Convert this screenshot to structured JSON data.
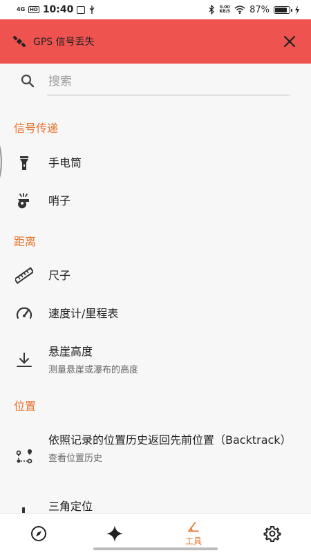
{
  "status_bar": {
    "network": "4G",
    "hd": "HD",
    "time": "10:40",
    "net_speed_value": "0.00",
    "net_speed_unit": "KB/S",
    "battery": "87%",
    "battery_level": 0.87
  },
  "gps_banner": {
    "text": "GPS 信号丢失"
  },
  "search": {
    "placeholder": "搜索"
  },
  "sections": {
    "signaling": "信号传递",
    "distance": "距离",
    "location": "位置"
  },
  "items": {
    "flashlight": {
      "title": "手电筒"
    },
    "whistle": {
      "title": "哨子"
    },
    "ruler": {
      "title": "尺子"
    },
    "speedometer": {
      "title": "速度计/里程表"
    },
    "cliff_height": {
      "title": "悬崖高度",
      "subtitle": "测量悬崖或瀑布的高度"
    },
    "backtrack": {
      "title": "依照记录的位置历史返回先前位置（Backtrack）",
      "subtitle": "查看位置历史"
    },
    "triangulate": {
      "title": "三角定位"
    }
  },
  "bottom_nav": {
    "tools_label": "工具",
    "accent": "#e8702a"
  },
  "colors": {
    "banner": "#ef5350",
    "accent": "#e8702a",
    "background": "#f7f7f7"
  }
}
